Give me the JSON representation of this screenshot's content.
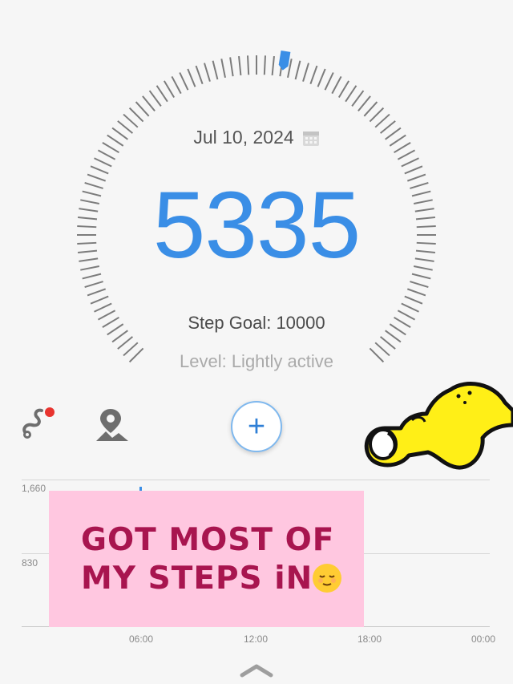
{
  "header": {
    "date": "Jul 10, 2024",
    "calendar_icon": "calendar-icon"
  },
  "summary": {
    "steps": "5335",
    "step_goal_text": "Step Goal: 10000",
    "level_text": "Level: Lightly active",
    "progress_fraction": 0.5335,
    "accent_color": "#3a8ee6"
  },
  "toolbar": {
    "items": [
      {
        "icon": "route-icon",
        "has_notification_dot": true
      },
      {
        "icon": "location-pin-icon"
      },
      {
        "icon": "plus-icon",
        "label": "+"
      },
      {
        "icon": "more-icon"
      }
    ]
  },
  "chart": {
    "y_ticks": [
      "1,660",
      "830"
    ],
    "x_ticks": [
      "06:00",
      "12:00",
      "18:00",
      "00:00"
    ]
  },
  "sticker": {
    "line1": "GOT MOST OF",
    "line2": "MY STEPS iN",
    "emoji": "relieved-face-emoji",
    "background": "#ffc7e0",
    "text_color": "#a8154f"
  },
  "footer": {
    "collapse_icon": "chevron-up-icon"
  }
}
